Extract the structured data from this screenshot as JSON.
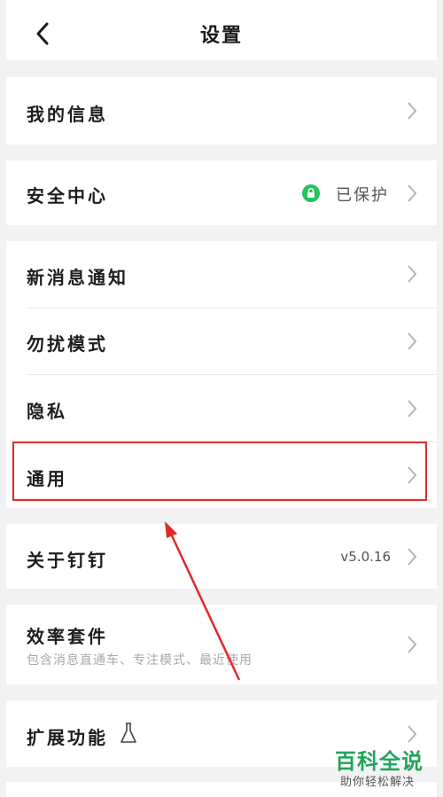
{
  "header": {
    "title": "设置",
    "back_icon": "chevron-left-icon"
  },
  "rows": {
    "my_info": {
      "label": "我的信息"
    },
    "security": {
      "label": "安全中心",
      "status": "已保护",
      "status_icon": "lock-icon",
      "status_color": "#22c55e"
    },
    "notifications": {
      "label": "新消息通知"
    },
    "dnd": {
      "label": "勿扰模式"
    },
    "privacy": {
      "label": "隐私"
    },
    "general": {
      "label": "通用"
    },
    "about": {
      "label": "关于钉钉",
      "version": "v5.0.16"
    },
    "efficiency": {
      "label": "效率套件",
      "sublabel": "包含消息直通车、专注模式、最近使用"
    },
    "extensions": {
      "label": "扩展功能",
      "icon": "flask-icon"
    }
  },
  "annotation": {
    "highlight_color": "#e02a2a"
  },
  "watermark": {
    "main": "百科全说",
    "sub": "助你轻松解决",
    "color": "#22a35a"
  }
}
